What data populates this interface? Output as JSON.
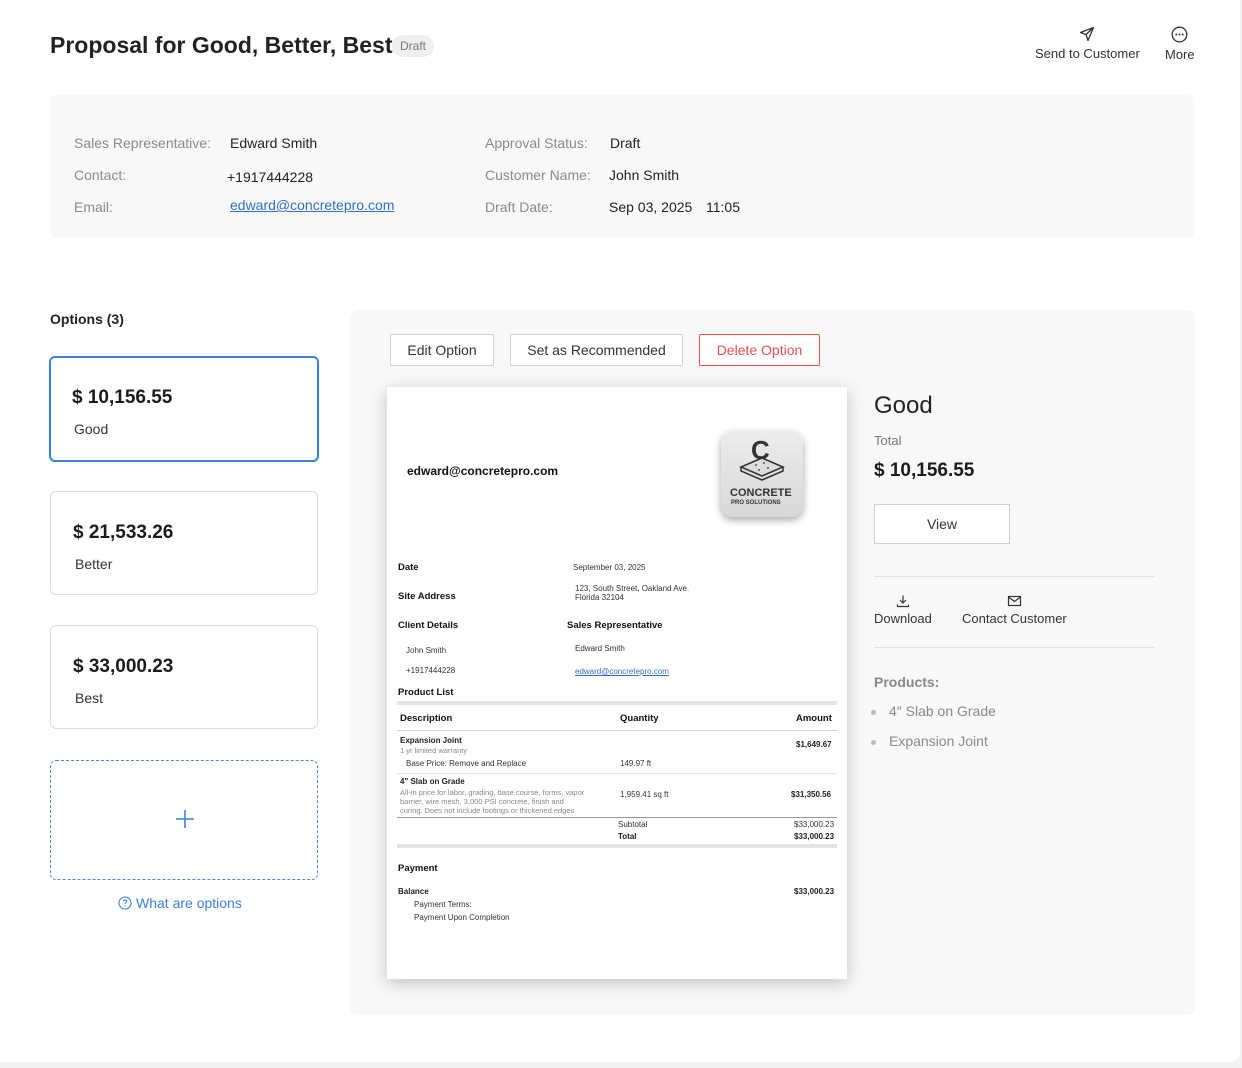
{
  "header": {
    "title": "Proposal for Good, Better, Best",
    "status_badge": "Draft",
    "send_label": "Send to Customer",
    "more_label": "More"
  },
  "info": {
    "sales_rep_label": "Sales Representative:",
    "sales_rep_value": "Edward Smith",
    "contact_label": "Contact:",
    "contact_value": "+1917444228",
    "email_label": "Email:",
    "email_value": "edward@concretepro.com",
    "approval_label": "Approval Status:",
    "approval_value": "Draft",
    "customer_label": "Customer Name:",
    "customer_value": "John Smith",
    "draft_date_label": "Draft Date:",
    "draft_date_value": "Sep 03, 2025",
    "draft_time_value": "11:05"
  },
  "options": {
    "heading": "Options (3)",
    "items": [
      {
        "price": "$ 10,156.55",
        "name": "Good"
      },
      {
        "price": "$ 21,533.26",
        "name": "Better"
      },
      {
        "price": "$ 33,000.23",
        "name": "Best"
      }
    ],
    "help_link": "What are options"
  },
  "toolbar": {
    "edit": "Edit Option",
    "recommend": "Set as Recommended",
    "delete": "Delete Option"
  },
  "document": {
    "email": "edward@concretepro.com",
    "logo_letter": "C",
    "logo_line1": "CONCRETE",
    "logo_line2": "PRO SOLUTIONS",
    "date_label": "Date",
    "date_value": "September 03, 2025",
    "site_label": "Site Address",
    "site_line1": "123, South Street, Oakland Ave.",
    "site_line2": "Florida 32104",
    "client_label": "Client Details",
    "client_name": "John Smith",
    "client_phone": "+1917444228",
    "rep_label": "Sales Representative",
    "rep_name": "Edward Smith",
    "rep_email": "edward@concretepro.com",
    "product_list_label": "Product List",
    "col_description": "Description",
    "col_quantity": "Quantity",
    "col_amount": "Amount",
    "items": [
      {
        "name": "Expansion Joint",
        "note": "1 yr limited warranty",
        "sub": "Base Price: Remove and Replace",
        "qty": "149.97 ft",
        "amount": "$1,649.67"
      },
      {
        "name": "4\" Slab on Grade",
        "note1": "All-in price for labor, grading, base course, forms, vapor",
        "note2": "barrier, wire mesh, 3,000 PSI concrete, finish and",
        "note3": "curing. Does not include footings or thickened edges",
        "qty": "1,959.41 sq ft",
        "amount": "$31,350.56"
      }
    ],
    "subtotal_label": "Subtotal",
    "subtotal_value": "$33,000.23",
    "total_label": "Total",
    "total_value": "$33,000.23",
    "payment_label": "Payment",
    "balance_label": "Balance",
    "balance_value": "$33,000.23",
    "terms_label": "Payment Terms:",
    "terms_value": "Payment Upon Completion"
  },
  "summary": {
    "title": "Good",
    "total_label": "Total",
    "total_value": "$ 10,156.55",
    "view_label": "View",
    "download_label": "Download",
    "contact_label": "Contact Customer",
    "products_label": "Products:",
    "products": [
      "4″ Slab on Grade",
      "Expansion Joint"
    ]
  },
  "colors": {
    "accent": "#3b82d6",
    "danger": "#e8504f",
    "panel": "#f8f8f8"
  }
}
